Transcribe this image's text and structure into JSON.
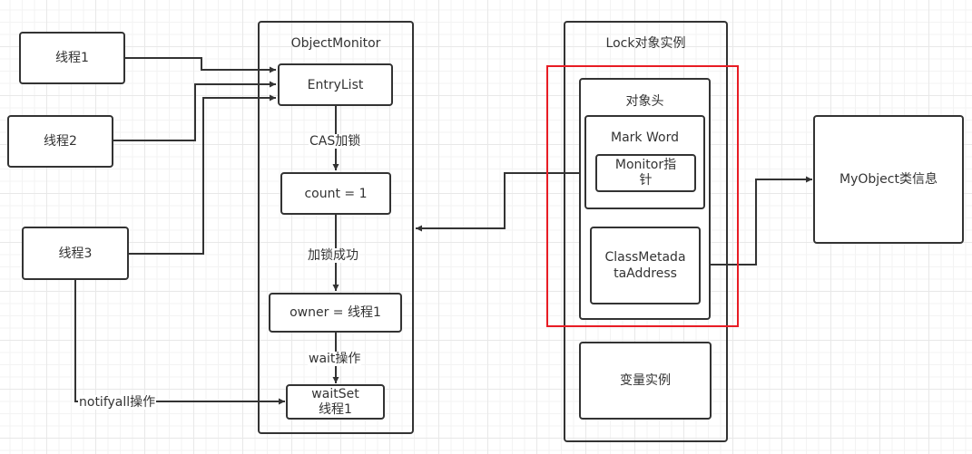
{
  "threads": [
    {
      "label": "线程1"
    },
    {
      "label": "线程2"
    },
    {
      "label": "线程3"
    }
  ],
  "object_monitor": {
    "title": "ObjectMonitor",
    "entry_list": "EntryList",
    "count": "count = 1",
    "owner": "owner = 线程1",
    "wait_set_line1": "waitSet",
    "wait_set_line2": "线程1"
  },
  "edge_labels": {
    "cas_lock": "CAS加锁",
    "lock_success": "加锁成功",
    "wait_op": "wait操作",
    "notify_all": "notifyall操作"
  },
  "lock_instance": {
    "title": "Lock对象实例",
    "object_header": "对象头",
    "mark_word": "Mark Word",
    "monitor_pointer_line1": "Monitor指",
    "monitor_pointer_line2": "针",
    "class_metadata_line1": "ClassMetada",
    "class_metadata_line2": "taAddress",
    "instance_variables": "变量实例"
  },
  "class_info": {
    "label": "MyObject类信息"
  },
  "colors": {
    "stroke": "#333333",
    "highlight": "#e81c24"
  }
}
